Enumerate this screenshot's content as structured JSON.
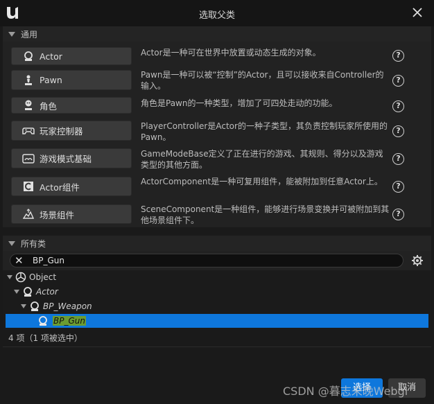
{
  "window": {
    "title": "选取父类"
  },
  "common": {
    "header": "通用",
    "items": [
      {
        "label": "Actor",
        "icon": "actor-icon",
        "description": "Actor是一种可在世界中放置或动态生成的对象。"
      },
      {
        "label": "Pawn",
        "icon": "pawn-icon",
        "description": "Pawn是一种可以被“控制”的Actor，且可以接收来自Controller的输入。"
      },
      {
        "label": "角色",
        "icon": "character-icon",
        "description": "角色是Pawn的一种类型，增加了可四处走动的功能。"
      },
      {
        "label": "玩家控制器",
        "icon": "gamepad-icon",
        "description": "PlayerController是Actor的一种子类型，其负责控制玩家所使用的Pawn。"
      },
      {
        "label": "游戏模式基础",
        "icon": "game-mode-icon",
        "description": "GameModeBase定义了正在进行的游戏、其规则、得分以及游戏类型的其他方面。"
      },
      {
        "label": "Actor组件",
        "icon": "actor-component-icon",
        "description": "ActorComponent是一种可复用组件，能被附加到任意Actor上。"
      },
      {
        "label": "场景组件",
        "icon": "scene-component-icon",
        "description": "SceneComponent是一种组件，能够进行场景变换并可被附加到其他场景组件下。"
      }
    ],
    "help_glyph": "?"
  },
  "all_classes": {
    "header": "所有类",
    "search": {
      "value": "BP_Gun",
      "clear_glyph": "✕"
    },
    "tree": [
      {
        "label": "Object"
      },
      {
        "label": "Actor"
      },
      {
        "label": "BP_Weapon"
      },
      {
        "label": "BP_Gun"
      }
    ],
    "status": "4 项（1 项被选中）"
  },
  "footer": {
    "select_label": "选择",
    "cancel_label": "取消"
  },
  "watermark": "CSDN @暮志未晚Webgl",
  "colors": {
    "accent": "#0e77dc",
    "highlight": "#6b9c32"
  }
}
